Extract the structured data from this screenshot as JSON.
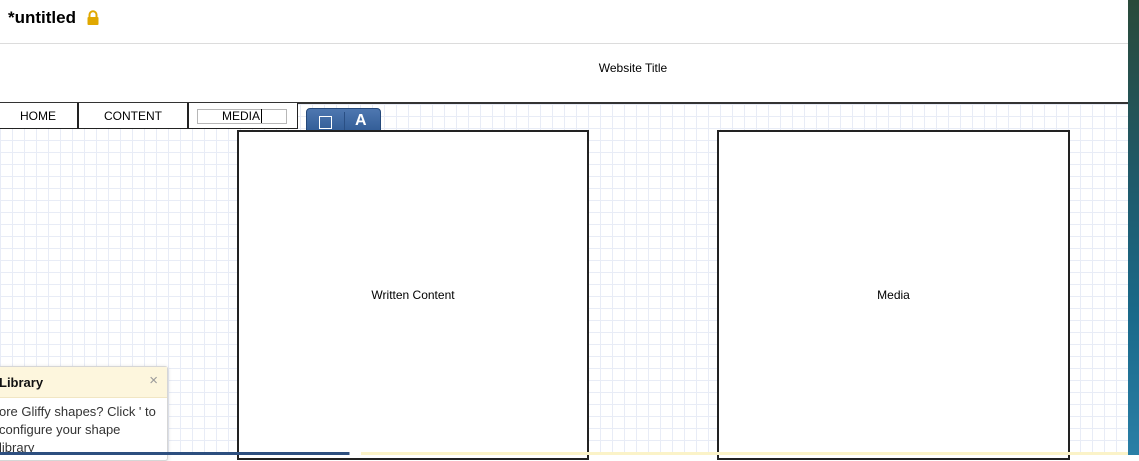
{
  "header": {
    "doc_title": "*untitled",
    "lock_icon": "lock-icon",
    "lock_color": "#e0a800"
  },
  "diagram": {
    "website_title": "Website Title",
    "nav": {
      "home": "HOME",
      "content": "CONTENT",
      "media_editing": "MEDIA"
    },
    "written_content": "Written Content",
    "media": "Media"
  },
  "mini_toolbar": {
    "shape_icon": "square-outline-icon",
    "text_button": "A",
    "color": "#3b66a0"
  },
  "library_panel": {
    "title": "Library",
    "close_glyph": "×",
    "body": "ore Gliffy shapes? Click ' to configure your shape library"
  }
}
